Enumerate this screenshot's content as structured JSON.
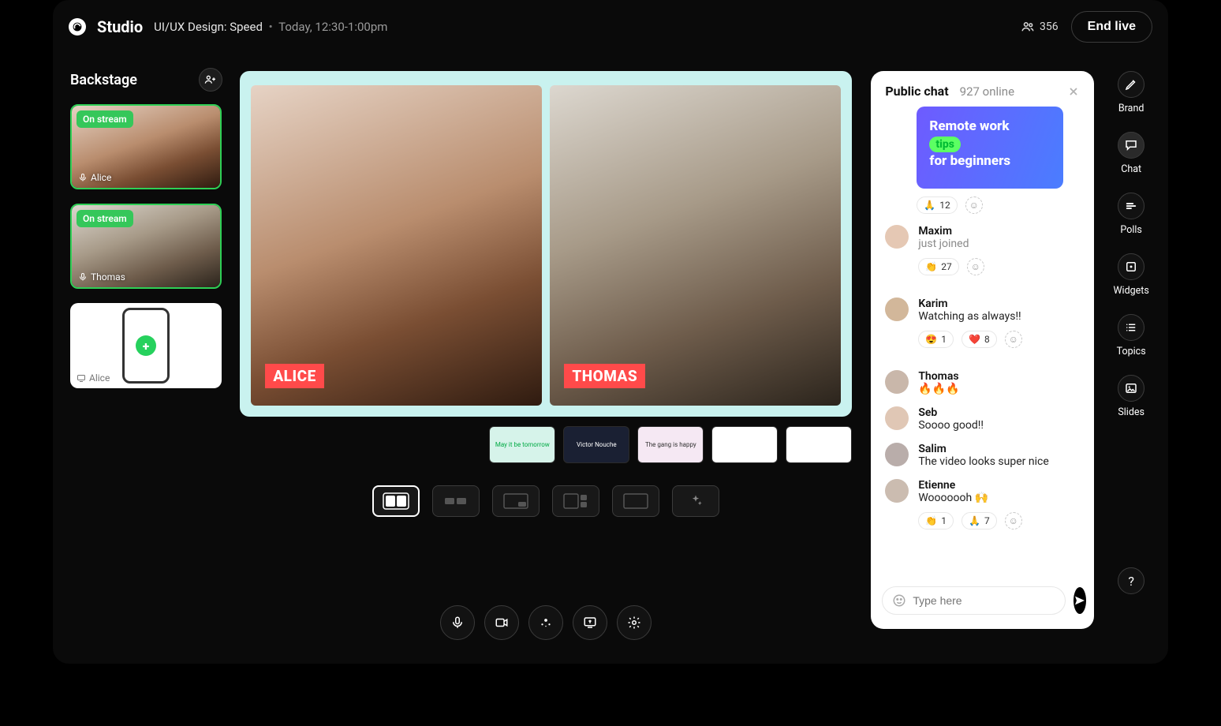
{
  "header": {
    "brand": "Studio",
    "session_title": "UI/UX Design: Speed",
    "session_time": "Today, 12:30-1:00pm",
    "viewers": "356",
    "end_live": "End live"
  },
  "backstage": {
    "title": "Backstage",
    "on_stream_label": "On stream",
    "items": [
      {
        "name": "Alice",
        "on_stream": true,
        "mic": true
      },
      {
        "name": "Thomas",
        "on_stream": true,
        "mic": true
      },
      {
        "name": "Alice",
        "on_stream": false,
        "screen": true
      }
    ]
  },
  "stage": {
    "feeds": [
      {
        "label": "ALICE"
      },
      {
        "label": "THOMAS"
      }
    ],
    "scenes": [
      {
        "label": "May it be tomorrow"
      },
      {
        "label": "Victor Nouche"
      },
      {
        "label": "The gang is happy"
      },
      {
        "label": ""
      },
      {
        "label": ""
      }
    ]
  },
  "chat": {
    "title": "Public chat",
    "online": "927 online",
    "promo": {
      "line1": "Remote work",
      "chip": "tips",
      "line2": "for beginners"
    },
    "promo_reacts": [
      {
        "emoji": "🙏",
        "count": "12"
      }
    ],
    "messages": [
      {
        "who": "Maxim",
        "text": "just joined",
        "muted": true,
        "reacts": [
          {
            "emoji": "👏",
            "count": "27"
          }
        ]
      },
      {
        "who": "Karim",
        "text": "Watching as always!!",
        "reacts": [
          {
            "emoji": "😍",
            "count": "1"
          },
          {
            "emoji": "❤️",
            "count": "8"
          }
        ]
      },
      {
        "who": "Thomas",
        "text": "🔥🔥🔥"
      },
      {
        "who": "Seb",
        "text": "Soooo good!!"
      },
      {
        "who": "Salim",
        "text": "The video looks super nice"
      },
      {
        "who": "Etienne",
        "text": "Wooooooh 🙌",
        "reacts": [
          {
            "emoji": "👏",
            "count": "1"
          },
          {
            "emoji": "🙏",
            "count": "7"
          }
        ]
      }
    ],
    "placeholder": "Type here"
  },
  "rail": [
    {
      "label": "Brand",
      "icon": "pencil"
    },
    {
      "label": "Chat",
      "icon": "chat",
      "active": true
    },
    {
      "label": "Polls",
      "icon": "poll"
    },
    {
      "label": "Widgets",
      "icon": "widget"
    },
    {
      "label": "Topics",
      "icon": "list"
    },
    {
      "label": "Slides",
      "icon": "image"
    }
  ],
  "avatar_colors": [
    "#e5c8b4",
    "#d2b79a",
    "#c9b7aa",
    "#e0c7b5",
    "#b9adaa",
    "#cbbcb0"
  ]
}
